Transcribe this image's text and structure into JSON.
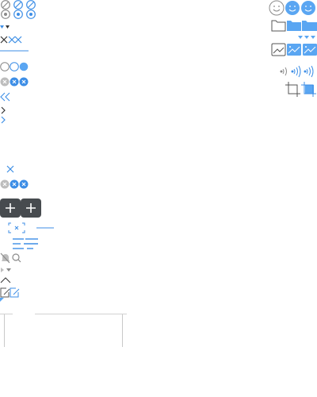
{
  "colors": {
    "accent": "#3d8ee6",
    "accent_light": "#5aa6f2",
    "gray": "#8a8a8a",
    "dark": "#333333",
    "button_dark": "#474b4f",
    "disabled": "#bdbdbd"
  },
  "icons": [
    "eye-slash-icon",
    "eye-icon",
    "close-icon",
    "underline-tab-icon",
    "radio-icon",
    "clear-icon",
    "chevron-double-left-icon",
    "chevron-right-icon",
    "plus-icon",
    "focus-frame-icon",
    "align-icon",
    "mute-bell-icon",
    "search-icon",
    "chevron-up-icon",
    "edit-icon",
    "smiley-icon",
    "folder-icon",
    "image-icon",
    "signal-icon",
    "crop-icon"
  ]
}
